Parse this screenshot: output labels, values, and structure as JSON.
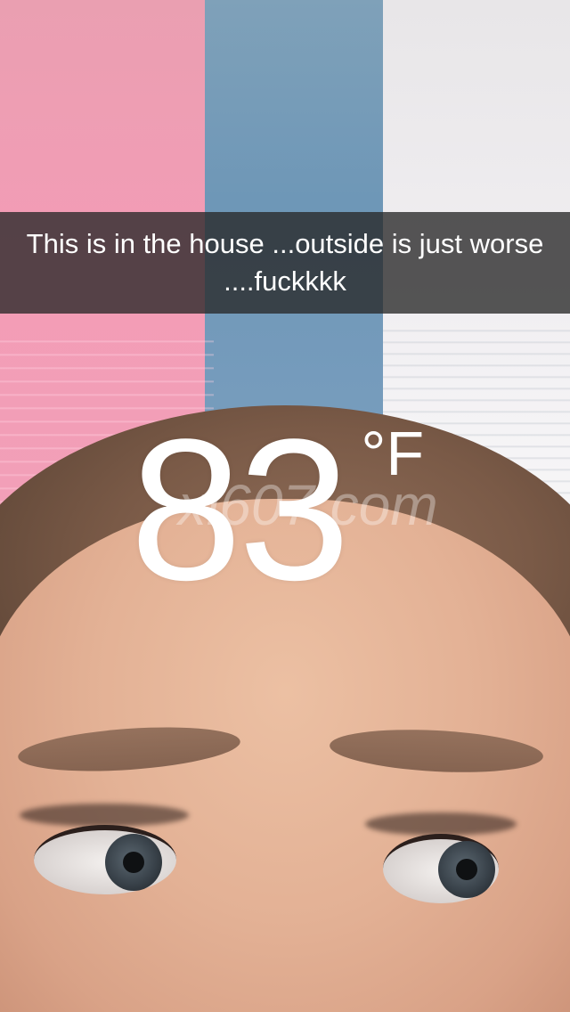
{
  "snap": {
    "caption": "This is in the house ...outside is just worse ....fuckkkk",
    "temperature_filter": {
      "value": "83",
      "unit": "°F"
    },
    "watermark": "xi607.com"
  },
  "colors": {
    "caption_bar": "#282828",
    "text": "#ffffff"
  }
}
